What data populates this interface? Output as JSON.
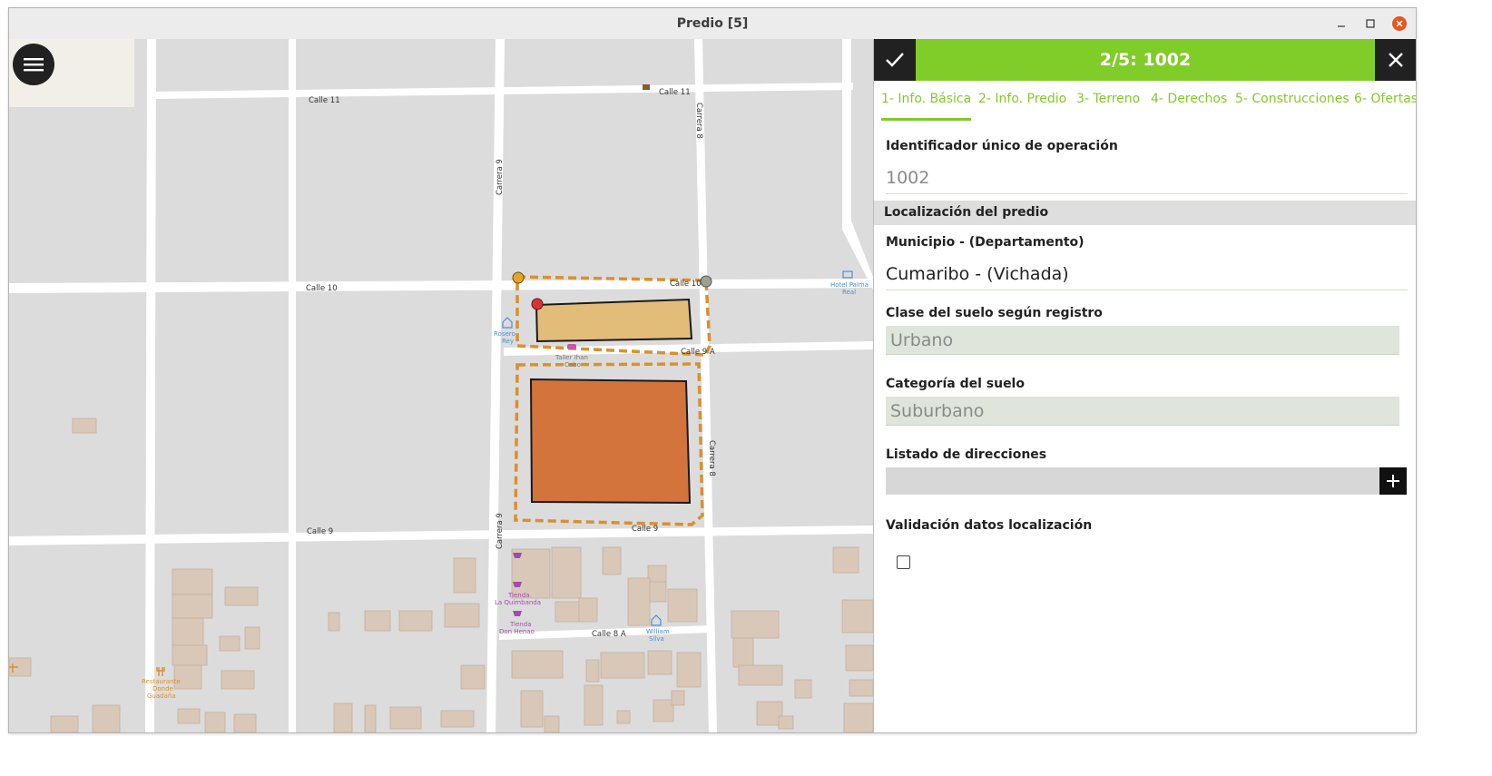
{
  "window": {
    "title": "Predio [5]",
    "controls": [
      "minimize-icon",
      "maximize-icon",
      "close-icon"
    ],
    "close_color": "#e95420"
  },
  "map": {
    "menu_icon": "hamburger-menu-icon",
    "streets": {
      "calle_11_left": "Calle 11",
      "calle_11_right": "Calle 11",
      "calle_10_left": "Calle 10",
      "calle_10_right": "Calle 10",
      "calle_9a": "Calle 9 A",
      "calle_9_left": "Calle 9",
      "calle_9_right": "Calle 9",
      "calle_8a": "Calle 8 A",
      "carrera_9_top": "Carrera 9",
      "carrera_9_bottom": "Carrera 9",
      "carrera_8_top": "Carrera 8",
      "carrera_8_right": "Carrera 8"
    },
    "pois": {
      "hotel_palma_real": [
        "Hotel Palma",
        "Real"
      ],
      "rosero_rey": [
        "Rosero",
        "Rey"
      ],
      "taller": [
        "Taller Ihan",
        "Cabo"
      ],
      "tienda_quimbaya": [
        "Tienda",
        "La Quimbanda"
      ],
      "tienda_don_henao": [
        "Tienda",
        "Don Henao"
      ],
      "william_silva": [
        "William",
        "Silva"
      ],
      "restaurante": [
        "Restaurante",
        "Donde",
        "Guadaña"
      ]
    },
    "colors": {
      "road": "#ffffff",
      "block": "#dcdcdc",
      "building": "#d9c8b8",
      "parcel_light": "#e2bd7a",
      "parcel_dark": "#d2743c",
      "dashed_outline": "#d9902e",
      "vertex_yellow": "#e2a52a",
      "vertex_red": "#d9333a",
      "vertex_gray": "#a0a08a"
    }
  },
  "panel": {
    "header": {
      "title": "2/5: 1002",
      "confirm_icon": "checkmark-icon",
      "close_icon": "close-icon",
      "accent": "#80cc28"
    },
    "tabs": [
      {
        "label": "1- Info. Básica",
        "active": true
      },
      {
        "label": "2- Info. Predio"
      },
      {
        "label": "3- Terreno"
      },
      {
        "label": "4- Derechos"
      },
      {
        "label": "5- Construcciones"
      },
      {
        "label": "6- Ofertas"
      }
    ],
    "fields": {
      "operation_id_label": "Identificador único de operación",
      "operation_id_value": "1002",
      "location_section": "Localización del predio",
      "municipio_label": "Municipio - (Departamento)",
      "municipio_value": "Cumaribo - (Vichada)",
      "clase_label": "Clase del suelo según registro",
      "clase_value": "Urbano",
      "categoria_label": "Categoría del suelo",
      "categoria_value": "Suburbano",
      "direcciones_label": "Listado de direcciones",
      "add_icon": "plus-icon",
      "validacion_label": "Validación datos localización",
      "validacion_checked": false
    }
  }
}
